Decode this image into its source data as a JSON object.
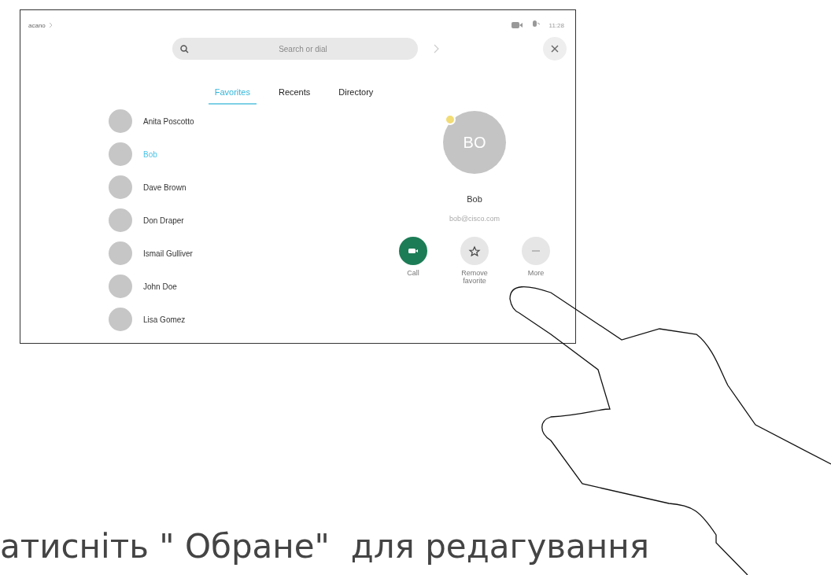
{
  "status_bar": {
    "breadcrumb": "acano",
    "time": "11:28"
  },
  "search": {
    "placeholder": "Search or dial"
  },
  "tabs": [
    {
      "label": "Favorites",
      "selected": true
    },
    {
      "label": "Recents",
      "selected": false
    },
    {
      "label": "Directory",
      "selected": false
    }
  ],
  "contacts": [
    {
      "name": "Anita Poscotto",
      "selected": false
    },
    {
      "name": "Bob",
      "selected": true
    },
    {
      "name": "Dave Brown",
      "selected": false
    },
    {
      "name": "Don Draper",
      "selected": false
    },
    {
      "name": "Ismail Gulliver",
      "selected": false
    },
    {
      "name": "John Doe",
      "selected": false
    },
    {
      "name": "Lisa Gomez",
      "selected": false
    }
  ],
  "details": {
    "initials": "BO",
    "name": "Bob",
    "email": "bob@cisco.com",
    "actions": [
      {
        "kind": "call",
        "label": "Call"
      },
      {
        "kind": "favorite",
        "label": "Remove favorite"
      },
      {
        "kind": "more",
        "label": "More"
      }
    ]
  },
  "caption": "атисніть \" Обране\"  для редагування"
}
